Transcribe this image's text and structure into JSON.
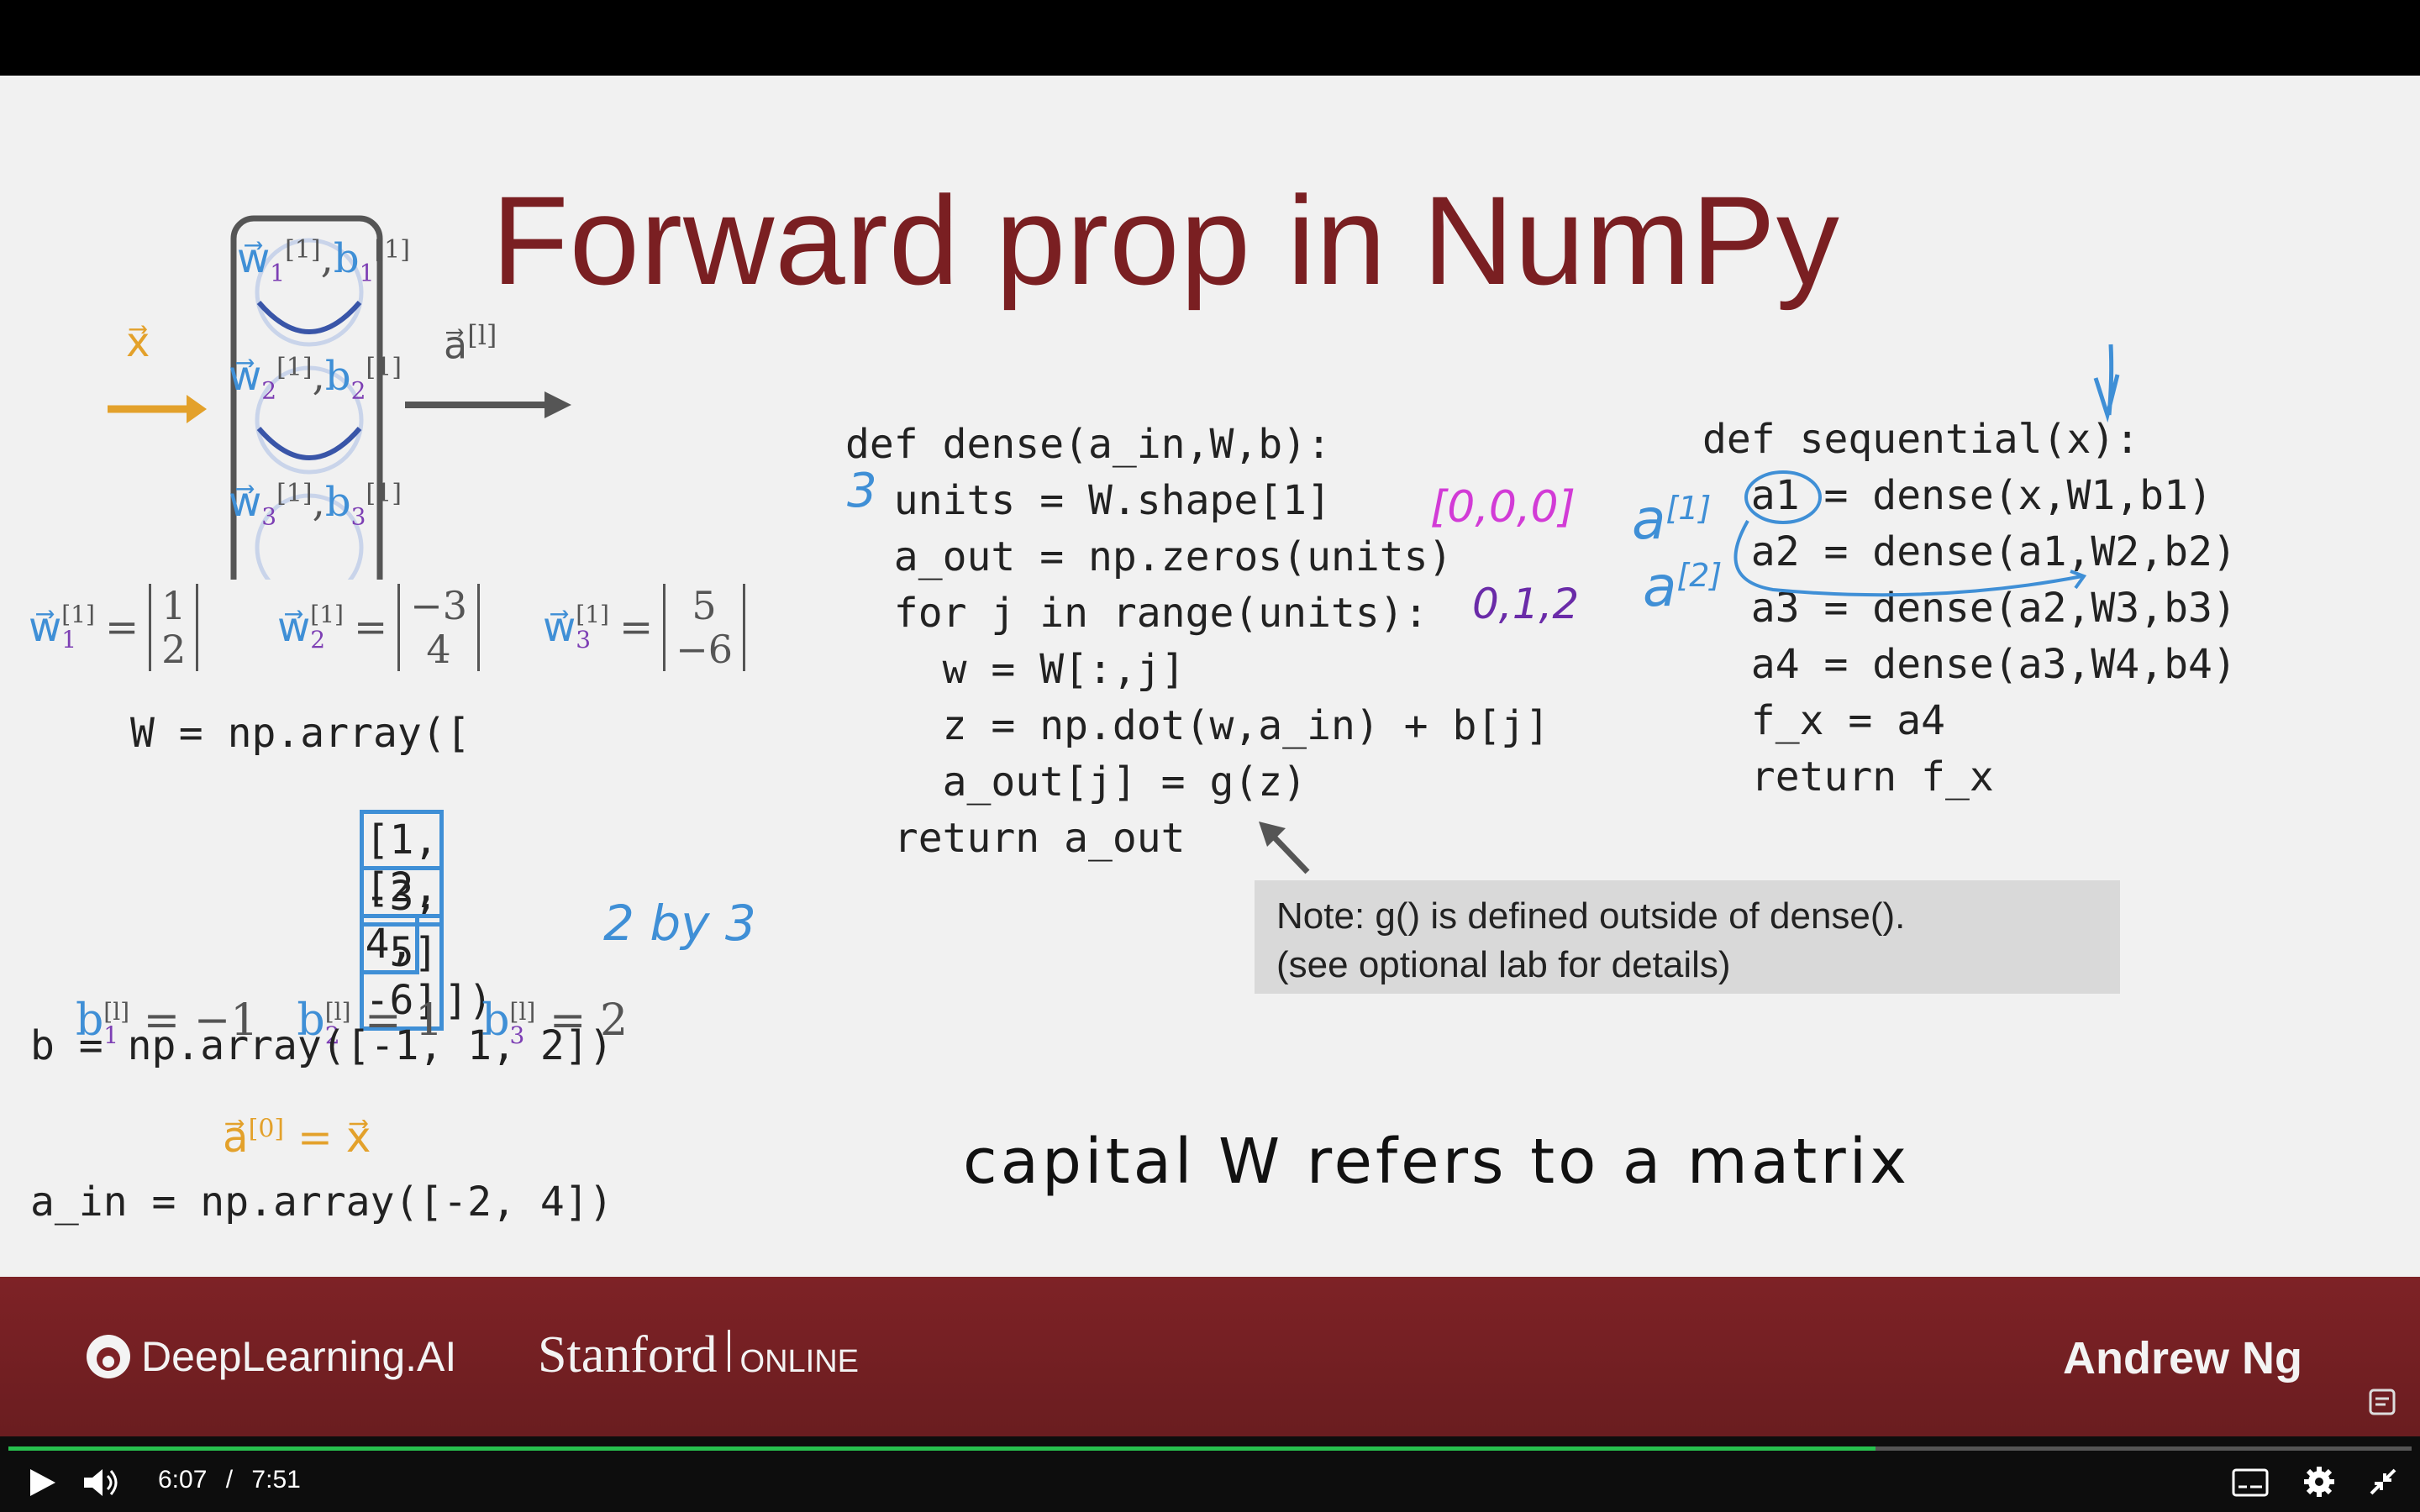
{
  "slide": {
    "title": "Forward prop in NumPy",
    "diagram": {
      "x_label": "x⃗",
      "a_label": "a⃗",
      "a_sup": "[l]",
      "neurons": [
        {
          "w": "w⃗",
          "w_sub": "1",
          "sup": "[1]",
          "b": "b",
          "b_sub": "1"
        },
        {
          "w": "w⃗",
          "w_sub": "2",
          "sup": "[1]",
          "b": "b",
          "b_sub": "2"
        },
        {
          "w": "w⃗",
          "w_sub": "3",
          "sup": "[1]",
          "b": "b",
          "b_sub": "3"
        }
      ]
    },
    "weights": [
      {
        "sym": "w⃗",
        "sub": "1",
        "sup": "[1]",
        "top": "1",
        "bottom": "2"
      },
      {
        "sym": "w⃗",
        "sub": "2",
        "sup": "[1]",
        "top": "−3",
        "bottom": "4"
      },
      {
        "sym": "w⃗",
        "sub": "3",
        "sup": "[1]",
        "top": "5",
        "bottom": "−6"
      }
    ],
    "W_code": {
      "line1": "W = np.array([",
      "row1": [
        "[1,",
        "-3,",
        " 5]"
      ],
      "row2": [
        "[2,",
        "4,",
        "-6]"
      ],
      "row2_end": "])"
    },
    "hw_2by3": "2 by 3",
    "biases": [
      {
        "sub": "1",
        "sup": "[l]",
        "value": "= −1"
      },
      {
        "sub": "2",
        "sup": "[l]",
        "value": "= 1"
      },
      {
        "sub": "3",
        "sup": "[l]",
        "value": "= 2"
      }
    ],
    "b_code": "b = np.array([-1, 1, 2])",
    "a0_label": "a⃗",
    "a0_sup": "[0]",
    "a0_rhs": "= x⃗",
    "ain_code": "a_in = np.array([-2, 4])",
    "dense_code": [
      "def dense(a_in,W,b):",
      "  units = W.shape[1]",
      "  a_out = np.zeros(units)",
      "  for j in range(units):",
      "    w = W[:,j]",
      "    z = np.dot(w,a_in) + b[j]",
      "    a_out[j] = g(z)",
      "  return a_out"
    ],
    "sequential_code": [
      "def sequential(x):",
      "  a1 = dense(x,W1,b1)",
      "  a2 = dense(a1,W2,b2)",
      "  a3 = dense(a2,W3,b3)",
      "  a4 = dense(a3,W4,b4)",
      "  f_x = a4",
      "  return f_x"
    ],
    "note_line1": "Note: g() is defined outside of dense().",
    "note_line2": "(see optional lab for details)",
    "hw_3": "3",
    "hw_zeros": "[0,0,0]",
    "hw_012": "0,1,2",
    "hw_a1": "a",
    "hw_a1_sup": "[1]",
    "hw_a2": "a",
    "hw_a2_sup": "[2]",
    "hw_capital": "capital W refers to a matrix"
  },
  "footer": {
    "brand1": "DeepLearning.AI",
    "brand2": "Stanford",
    "brand2_suffix": "ONLINE",
    "presenter": "Andrew Ng"
  },
  "player": {
    "current_time": "6:07",
    "separator": "/",
    "duration": "7:51",
    "progress": 0.777,
    "accent": "#27c04e"
  }
}
